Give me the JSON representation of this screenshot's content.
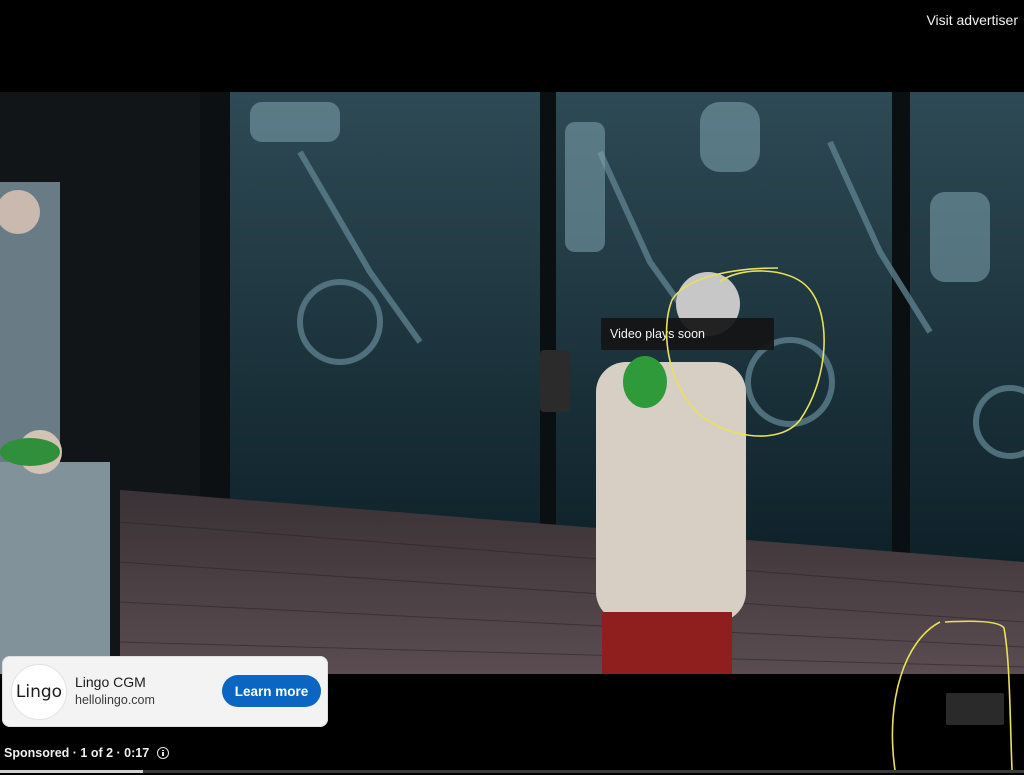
{
  "header": {
    "visit_advertiser": "Visit advertiser"
  },
  "video": {
    "status_tooltip": "Video plays soon",
    "progress_fraction": 0.14
  },
  "ad": {
    "logo_text": "Lingo",
    "name": "Lingo CGM",
    "url": "hellolingo.com",
    "cta_label": "Learn more"
  },
  "footer": {
    "sponsored_text": "Sponsored · 1 of 2 · 0:17",
    "info_icon": "info-icon"
  },
  "colors": {
    "cta_blue": "#0a66c2",
    "annotation_yellow": "#e8e15a",
    "background": "#000000"
  }
}
